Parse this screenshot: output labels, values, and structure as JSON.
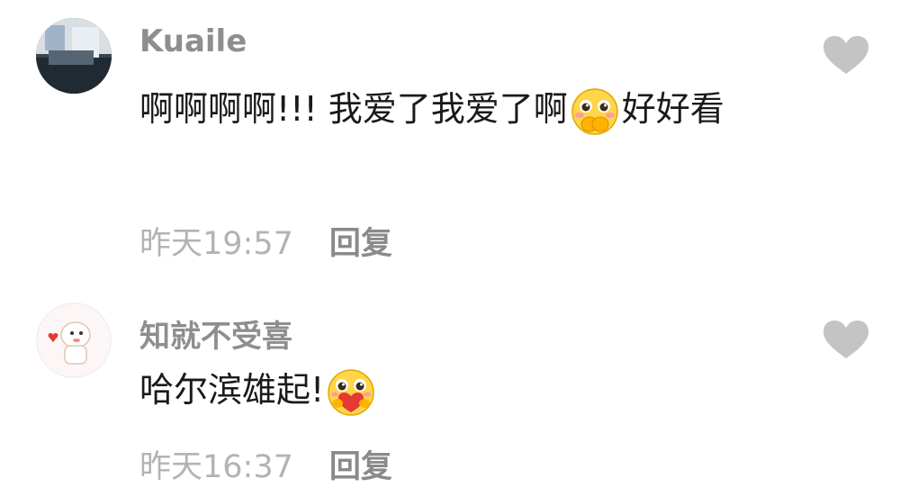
{
  "comments": [
    {
      "username": "Kuaile",
      "text_part1": "啊啊啊啊!!! 我爱了我爱了啊",
      "emoji": "shy-blush-emoji",
      "text_part2": "好好看",
      "timestamp": "昨天19:57",
      "reply_label": "回复",
      "like_icon": "heart-icon"
    },
    {
      "username": "知就不受喜",
      "text_part1": "哈尔滨雄起!",
      "emoji": "heart-hug-emoji",
      "timestamp": "昨天16:37",
      "reply_label": "回复",
      "like_icon": "heart-icon"
    }
  ],
  "colors": {
    "username": "#8e8e8e",
    "text": "#1a1a1a",
    "timestamp": "#b3b3b3",
    "reply": "#8a8a8a",
    "heart": "#c4c4c4"
  }
}
